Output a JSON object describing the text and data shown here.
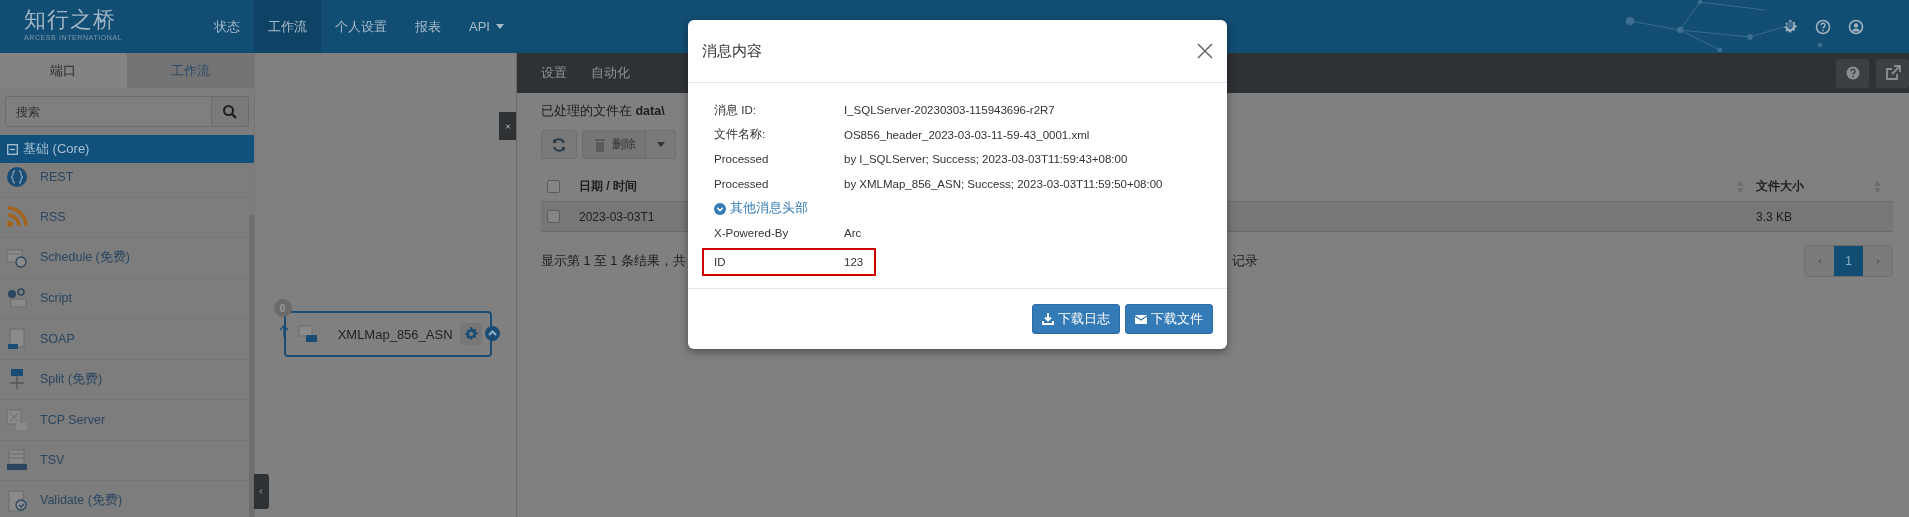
{
  "header": {
    "logo": {
      "title": "知行之桥",
      "subtitle": "ARCESB INTERNATIONAL"
    },
    "nav": [
      {
        "label": "状态",
        "selected": false,
        "dropdown": false
      },
      {
        "label": "工作流",
        "selected": true,
        "dropdown": false
      },
      {
        "label": "个人设置",
        "selected": false,
        "dropdown": false
      },
      {
        "label": "报表",
        "selected": false,
        "dropdown": false
      },
      {
        "label": "API",
        "selected": false,
        "dropdown": true
      }
    ]
  },
  "sidebar": {
    "tabs": [
      {
        "label": "端口",
        "selected": true
      },
      {
        "label": "工作流",
        "selected": false
      }
    ],
    "search": {
      "placeholder": "搜索"
    },
    "group": {
      "label": "基础 (Core)",
      "expanded": true
    },
    "items": [
      {
        "label": "REST"
      },
      {
        "label": "RSS"
      },
      {
        "label": "Schedule (免费)"
      },
      {
        "label": "Script"
      },
      {
        "label": "SOAP"
      },
      {
        "label": "Split (免费)"
      },
      {
        "label": "TCP Server"
      },
      {
        "label": "TSV"
      },
      {
        "label": "Validate (免费)"
      }
    ]
  },
  "canvas": {
    "node": {
      "label": "XMLMap_856_ASN",
      "count": "0"
    }
  },
  "panel": {
    "tabs": [
      {
        "label": "设置",
        "selected": false
      },
      {
        "label": "自动化",
        "selected": false
      }
    ],
    "info": "已处理的文件在 **data\\**",
    "delete_button": {
      "label": "删除",
      "disabled": true
    },
    "table": {
      "select_all": {
        "checked": false
      },
      "columns": [
        {
          "label": "日期 / 时间"
        },
        {
          "label": "文件大小"
        }
      ],
      "rows": [
        {
          "checked": false,
          "cells": [
            "2023-03-03T1",
            "3.3 KB"
          ]
        }
      ]
    },
    "summary": "显示第 1 至 1 条结果，共",
    "summary_end": "记录",
    "pagination": [
      {
        "label": "1",
        "selected": true
      }
    ]
  },
  "dialog": {
    "title": "消息内容",
    "fields": [
      {
        "label": "消息 ID:",
        "value": "I_SQLServer-20230303-115943696-r2R7"
      },
      {
        "label": "文件名称:",
        "value": "OS856_header_2023-03-03-11-59-43_0001.xml"
      },
      {
        "label": "Processed",
        "value": "by I_SQLServer; Success; 2023-03-03T11:59:43+08:00"
      },
      {
        "label": "Processed",
        "value": "by XMLMap_856_ASN; Success; 2023-03-03T11:59:50+08:00"
      }
    ],
    "toggle": {
      "label": "其他消息头部",
      "expanded": true
    },
    "headers": [
      {
        "label": "X-Powered-By",
        "value": "Arc",
        "highlighted": false
      },
      {
        "label": "ID",
        "value": "123",
        "highlighted": true
      }
    ],
    "buttons": [
      {
        "label": "下载日志",
        "kind": "download"
      },
      {
        "label": "下载文件",
        "kind": "mail"
      }
    ]
  }
}
